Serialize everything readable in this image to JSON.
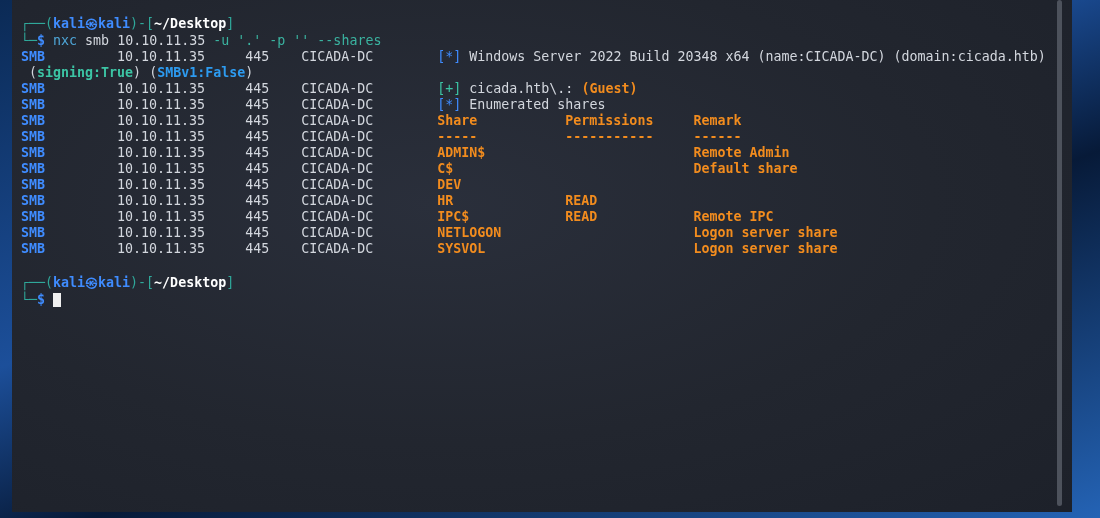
{
  "prompts": [
    {
      "line1": [
        {
          "text": "┌──(",
          "kind": "frame"
        },
        {
          "text": "kali㉿kali",
          "kind": "user"
        },
        {
          "text": ")-[",
          "kind": "frame"
        },
        {
          "text": "~/Desktop",
          "kind": "path"
        },
        {
          "text": "]",
          "kind": "frame"
        }
      ],
      "line2": [
        {
          "text": "└─",
          "kind": "frame"
        },
        {
          "text": "$",
          "kind": "symbol"
        }
      ],
      "command": [
        {
          "text": "nxc",
          "kind": "program"
        },
        {
          "text": "smb",
          "kind": "arg"
        },
        {
          "text": "10.10.11.35",
          "kind": "arg"
        },
        {
          "text": "-u",
          "kind": "option"
        },
        {
          "text": "'.'",
          "kind": "option"
        },
        {
          "text": "-p",
          "kind": "option"
        },
        {
          "text": "''",
          "kind": "option"
        },
        {
          "text": "--shares",
          "kind": "option"
        }
      ],
      "cursor": false
    },
    {
      "line1": [
        {
          "text": "┌──(",
          "kind": "frame"
        },
        {
          "text": "kali㉿kali",
          "kind": "user"
        },
        {
          "text": ")-[",
          "kind": "frame"
        },
        {
          "text": "~/Desktop",
          "kind": "path"
        },
        {
          "text": "]",
          "kind": "frame"
        }
      ],
      "line2": [
        {
          "text": "└─",
          "kind": "frame"
        },
        {
          "text": "$",
          "kind": "symbol"
        }
      ],
      "cursor": true
    }
  ],
  "output": [
    {
      "kind": "status",
      "protocol": "SMB",
      "host": "10.10.11.35",
      "port": "445",
      "name": "CICADA-DC",
      "marker": {
        "text": "[*]",
        "color": "#3f8cff"
      },
      "text": "Windows Server 2022 Build 20348 x64 (name:CICADA-DC) (domain:cicada.htb)"
    },
    {
      "kind": "wrap",
      "parts": [
        {
          "text": "(",
          "kind": "plain"
        },
        {
          "text": "signing:True",
          "kind": "good"
        },
        {
          "text": ")",
          "kind": "plain"
        },
        {
          "text": "(",
          "kind": "plain"
        },
        {
          "text": "SMBv1:False",
          "kind": "note"
        },
        {
          "text": ")",
          "kind": "plain"
        }
      ]
    },
    {
      "kind": "status",
      "protocol": "SMB",
      "host": "10.10.11.35",
      "port": "445",
      "name": "CICADA-DC",
      "marker": {
        "text": "[+]",
        "color": "#3cc4a4"
      },
      "text": "cicada.htb\\.:",
      "highlight": "(Guest)"
    },
    {
      "kind": "status",
      "protocol": "SMB",
      "host": "10.10.11.35",
      "port": "445",
      "name": "CICADA-DC",
      "marker": {
        "text": "[*]",
        "color": "#3f8cff"
      },
      "text": "Enumerated shares"
    },
    {
      "kind": "table",
      "protocol": "SMB",
      "host": "10.10.11.35",
      "port": "445",
      "name": "CICADA-DC",
      "cells": [
        "Share",
        "Permissions",
        "Remark"
      ]
    },
    {
      "kind": "table",
      "protocol": "SMB",
      "host": "10.10.11.35",
      "port": "445",
      "name": "CICADA-DC",
      "cells": [
        "-----",
        "-----------",
        "------"
      ]
    },
    {
      "kind": "table",
      "protocol": "SMB",
      "host": "10.10.11.35",
      "port": "445",
      "name": "CICADA-DC",
      "cells": [
        "ADMIN$",
        "",
        "Remote Admin"
      ]
    },
    {
      "kind": "table",
      "protocol": "SMB",
      "host": "10.10.11.35",
      "port": "445",
      "name": "CICADA-DC",
      "cells": [
        "C$",
        "",
        "Default share"
      ]
    },
    {
      "kind": "table",
      "protocol": "SMB",
      "host": "10.10.11.35",
      "port": "445",
      "name": "CICADA-DC",
      "cells": [
        "DEV",
        "",
        ""
      ]
    },
    {
      "kind": "table",
      "protocol": "SMB",
      "host": "10.10.11.35",
      "port": "445",
      "name": "CICADA-DC",
      "cells": [
        "HR",
        "READ",
        ""
      ]
    },
    {
      "kind": "table",
      "protocol": "SMB",
      "host": "10.10.11.35",
      "port": "445",
      "name": "CICADA-DC",
      "cells": [
        "IPC$",
        "READ",
        "Remote IPC"
      ]
    },
    {
      "kind": "table",
      "protocol": "SMB",
      "host": "10.10.11.35",
      "port": "445",
      "name": "CICADA-DC",
      "cells": [
        "NETLOGON",
        "",
        "Logon server share"
      ]
    },
    {
      "kind": "table",
      "protocol": "SMB",
      "host": "10.10.11.35",
      "port": "445",
      "name": "CICADA-DC",
      "cells": [
        "SYSVOL",
        "",
        "Logon server share"
      ]
    }
  ]
}
